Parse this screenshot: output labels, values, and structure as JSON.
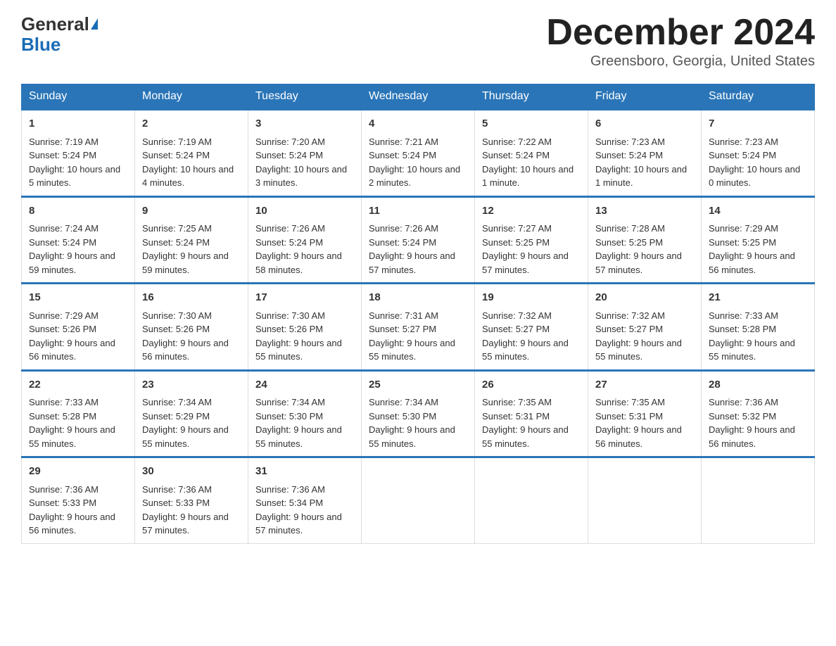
{
  "header": {
    "logo_general": "General",
    "logo_blue": "Blue",
    "month_title": "December 2024",
    "location": "Greensboro, Georgia, United States"
  },
  "days_of_week": [
    "Sunday",
    "Monday",
    "Tuesday",
    "Wednesday",
    "Thursday",
    "Friday",
    "Saturday"
  ],
  "weeks": [
    [
      {
        "day": "1",
        "sunrise": "7:19 AM",
        "sunset": "5:24 PM",
        "daylight": "10 hours and 5 minutes."
      },
      {
        "day": "2",
        "sunrise": "7:19 AM",
        "sunset": "5:24 PM",
        "daylight": "10 hours and 4 minutes."
      },
      {
        "day": "3",
        "sunrise": "7:20 AM",
        "sunset": "5:24 PM",
        "daylight": "10 hours and 3 minutes."
      },
      {
        "day": "4",
        "sunrise": "7:21 AM",
        "sunset": "5:24 PM",
        "daylight": "10 hours and 2 minutes."
      },
      {
        "day": "5",
        "sunrise": "7:22 AM",
        "sunset": "5:24 PM",
        "daylight": "10 hours and 1 minute."
      },
      {
        "day": "6",
        "sunrise": "7:23 AM",
        "sunset": "5:24 PM",
        "daylight": "10 hours and 1 minute."
      },
      {
        "day": "7",
        "sunrise": "7:23 AM",
        "sunset": "5:24 PM",
        "daylight": "10 hours and 0 minutes."
      }
    ],
    [
      {
        "day": "8",
        "sunrise": "7:24 AM",
        "sunset": "5:24 PM",
        "daylight": "9 hours and 59 minutes."
      },
      {
        "day": "9",
        "sunrise": "7:25 AM",
        "sunset": "5:24 PM",
        "daylight": "9 hours and 59 minutes."
      },
      {
        "day": "10",
        "sunrise": "7:26 AM",
        "sunset": "5:24 PM",
        "daylight": "9 hours and 58 minutes."
      },
      {
        "day": "11",
        "sunrise": "7:26 AM",
        "sunset": "5:24 PM",
        "daylight": "9 hours and 57 minutes."
      },
      {
        "day": "12",
        "sunrise": "7:27 AM",
        "sunset": "5:25 PM",
        "daylight": "9 hours and 57 minutes."
      },
      {
        "day": "13",
        "sunrise": "7:28 AM",
        "sunset": "5:25 PM",
        "daylight": "9 hours and 57 minutes."
      },
      {
        "day": "14",
        "sunrise": "7:29 AM",
        "sunset": "5:25 PM",
        "daylight": "9 hours and 56 minutes."
      }
    ],
    [
      {
        "day": "15",
        "sunrise": "7:29 AM",
        "sunset": "5:26 PM",
        "daylight": "9 hours and 56 minutes."
      },
      {
        "day": "16",
        "sunrise": "7:30 AM",
        "sunset": "5:26 PM",
        "daylight": "9 hours and 56 minutes."
      },
      {
        "day": "17",
        "sunrise": "7:30 AM",
        "sunset": "5:26 PM",
        "daylight": "9 hours and 55 minutes."
      },
      {
        "day": "18",
        "sunrise": "7:31 AM",
        "sunset": "5:27 PM",
        "daylight": "9 hours and 55 minutes."
      },
      {
        "day": "19",
        "sunrise": "7:32 AM",
        "sunset": "5:27 PM",
        "daylight": "9 hours and 55 minutes."
      },
      {
        "day": "20",
        "sunrise": "7:32 AM",
        "sunset": "5:27 PM",
        "daylight": "9 hours and 55 minutes."
      },
      {
        "day": "21",
        "sunrise": "7:33 AM",
        "sunset": "5:28 PM",
        "daylight": "9 hours and 55 minutes."
      }
    ],
    [
      {
        "day": "22",
        "sunrise": "7:33 AM",
        "sunset": "5:28 PM",
        "daylight": "9 hours and 55 minutes."
      },
      {
        "day": "23",
        "sunrise": "7:34 AM",
        "sunset": "5:29 PM",
        "daylight": "9 hours and 55 minutes."
      },
      {
        "day": "24",
        "sunrise": "7:34 AM",
        "sunset": "5:30 PM",
        "daylight": "9 hours and 55 minutes."
      },
      {
        "day": "25",
        "sunrise": "7:34 AM",
        "sunset": "5:30 PM",
        "daylight": "9 hours and 55 minutes."
      },
      {
        "day": "26",
        "sunrise": "7:35 AM",
        "sunset": "5:31 PM",
        "daylight": "9 hours and 55 minutes."
      },
      {
        "day": "27",
        "sunrise": "7:35 AM",
        "sunset": "5:31 PM",
        "daylight": "9 hours and 56 minutes."
      },
      {
        "day": "28",
        "sunrise": "7:36 AM",
        "sunset": "5:32 PM",
        "daylight": "9 hours and 56 minutes."
      }
    ],
    [
      {
        "day": "29",
        "sunrise": "7:36 AM",
        "sunset": "5:33 PM",
        "daylight": "9 hours and 56 minutes."
      },
      {
        "day": "30",
        "sunrise": "7:36 AM",
        "sunset": "5:33 PM",
        "daylight": "9 hours and 57 minutes."
      },
      {
        "day": "31",
        "sunrise": "7:36 AM",
        "sunset": "5:34 PM",
        "daylight": "9 hours and 57 minutes."
      },
      null,
      null,
      null,
      null
    ]
  ],
  "labels": {
    "sunrise": "Sunrise:",
    "sunset": "Sunset:",
    "daylight": "Daylight:"
  }
}
